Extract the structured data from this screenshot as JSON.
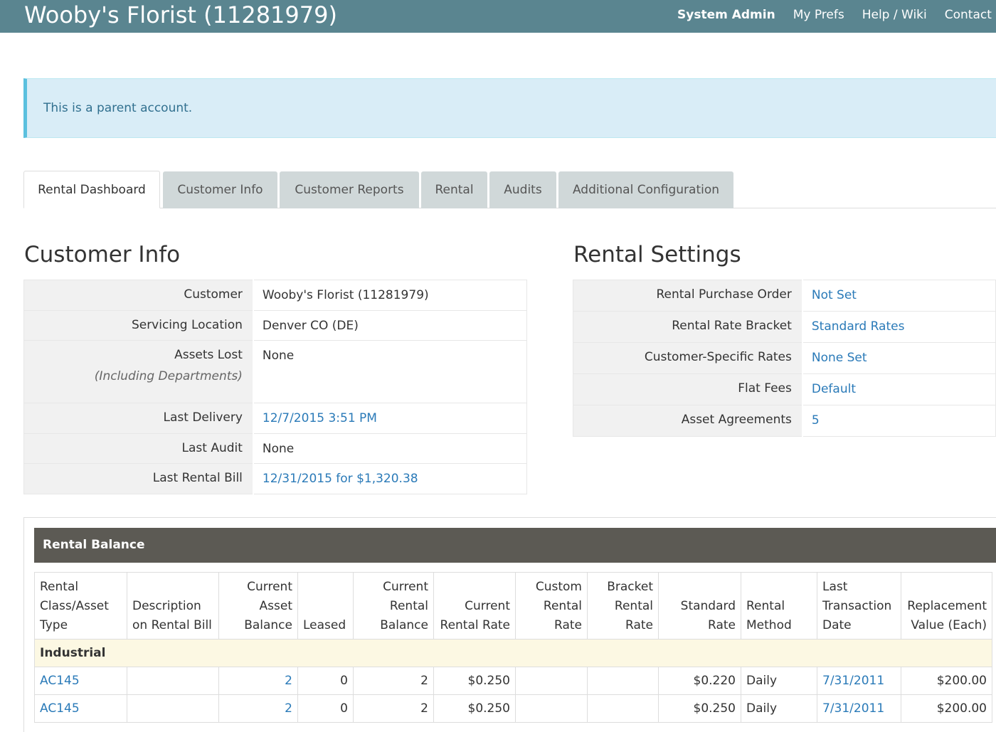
{
  "app": {
    "title": "Wooby's Florist (11281979)"
  },
  "topnav": [
    "System Admin",
    "My Prefs",
    "Help / Wiki",
    "Contact Support"
  ],
  "alert": {
    "text": "This is a parent account."
  },
  "tabs": [
    "Rental Dashboard",
    "Customer Info",
    "Customer Reports",
    "Rental",
    "Audits",
    "Additional Configuration"
  ],
  "customer_info": {
    "title": "Customer Info",
    "rows": [
      {
        "key": "Customer",
        "value": "Wooby's Florist (11281979)"
      },
      {
        "key": "Servicing Location",
        "value": "Denver CO (DE)"
      },
      {
        "key": "Assets Lost",
        "sub": "(Including Departments)",
        "value": "None"
      },
      {
        "key": "Last Delivery",
        "value": "12/7/2015 3:51 PM"
      },
      {
        "key": "Last Audit",
        "value": "None"
      },
      {
        "key": "Last Rental Bill",
        "value": "12/31/2015 for $1,320.38"
      }
    ]
  },
  "rental_settings": {
    "title": "Rental Settings",
    "rows": [
      {
        "key": "Rental Purchase Order",
        "value": "Not Set"
      },
      {
        "key": "Rental Rate Bracket",
        "value": "Standard Rates"
      },
      {
        "key": "Customer-Specific Rates",
        "value": "None Set"
      },
      {
        "key": "Flat Fees",
        "value": "Default"
      },
      {
        "key": "Asset Agreements",
        "value": "5"
      }
    ]
  },
  "rental_balance": {
    "title": "Rental Balance",
    "columns": [
      "Rental Class/Asset Type",
      "Description on Rental Bill",
      "Current Asset Balance",
      "Leased",
      "Current Rental Balance",
      "Current Rental Rate",
      "Custom Rental Rate",
      "Bracket Rental Rate",
      "Standard Rate",
      "Rental Method",
      "Last Transaction Date",
      "Replacement Value (Each)"
    ],
    "group": "Industrial",
    "rows": [
      [
        "AC145",
        "",
        "2",
        "0",
        "2",
        "$0.250",
        "",
        "",
        "$0.220",
        "Daily",
        "7/31/2011",
        "$200.00"
      ],
      [
        "AC145",
        "",
        "2",
        "0",
        "2",
        "$0.250",
        "",
        "",
        "$0.250",
        "Daily",
        "7/31/2011",
        "$200.00"
      ]
    ]
  }
}
